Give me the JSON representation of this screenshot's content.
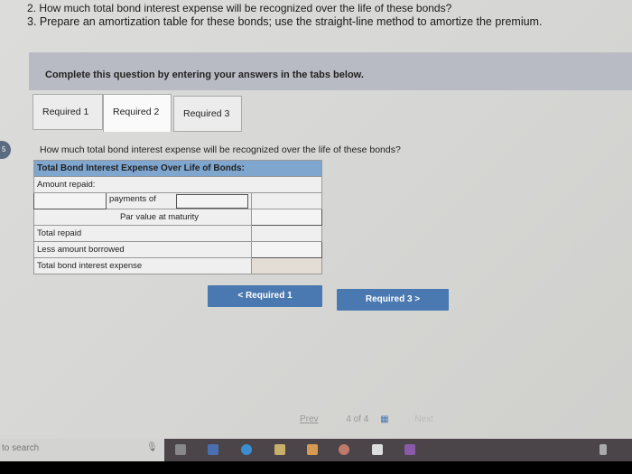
{
  "questions": [
    "2. How much total bond interest expense will be recognized over the life of these bonds?",
    "3. Prepare an amortization table for these bonds; use the straight-line method to amortize the premium."
  ],
  "banner": "Complete this question by entering your answers in the tabs below.",
  "tabs": [
    {
      "label": "Required 1"
    },
    {
      "label": "Required 2"
    },
    {
      "label": "Required 3"
    }
  ],
  "side_badge": "5",
  "question": "How much total bond interest expense will be recognized over the life of these bonds?",
  "table": {
    "header": "Total Bond Interest Expense Over Life of Bonds:",
    "amount_repaid": "Amount repaid:",
    "payments_of": "payments of",
    "par_value": "Par value at maturity",
    "total_repaid": "Total repaid",
    "less_borrowed": "Less amount borrowed",
    "total_interest": "Total bond interest expense"
  },
  "buttons": {
    "prev": "< Required 1",
    "next": "Required 3 >"
  },
  "nav": {
    "prev": "Prev",
    "page": "4 of 4",
    "next": "Next"
  },
  "taskbar": {
    "search": "to search"
  },
  "colors": {
    "accent": "#4a78b0",
    "header": "#7ea6cf"
  }
}
